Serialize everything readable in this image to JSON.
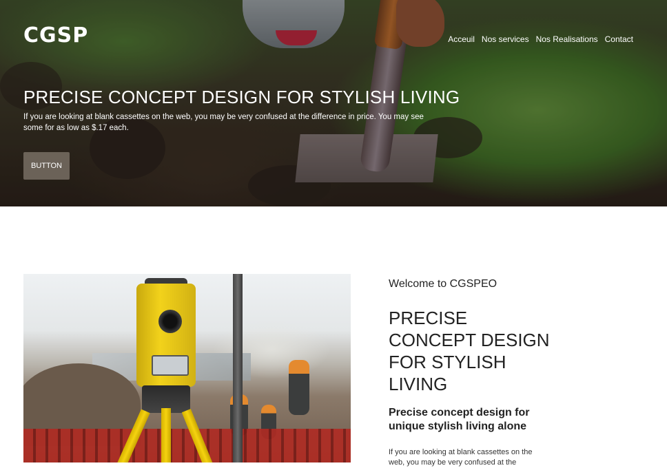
{
  "brand": {
    "logo_text": "CGSP"
  },
  "nav": {
    "items": [
      {
        "label": "Acceuil"
      },
      {
        "label": "Nos services"
      },
      {
        "label": "Nos Realisations"
      },
      {
        "label": "Contact"
      }
    ]
  },
  "hero": {
    "title": "PRECISE CONCEPT DESIGN FOR STYLISH LIVING",
    "text": "If you are looking at blank cassettes on the web, you may be very confused at the difference in price. You may see some for as low as $.17 each.",
    "button_label": "BUTTON",
    "image": "garden-shovel-digging-photo"
  },
  "about": {
    "image": "surveyor-total-station-construction-photo",
    "welcome": "Welcome to CGSPEO",
    "heading": "PRECISE CONCEPT DESIGN FOR STYLISH LIVING",
    "subheading": "Precise concept design for unique stylish living alone",
    "body": "If you are looking at blank cassettes on the web, you may be very confused at the"
  },
  "colors": {
    "text_dark": "#222222",
    "hero_text": "#ffffff",
    "button_bg": "#786e64"
  }
}
